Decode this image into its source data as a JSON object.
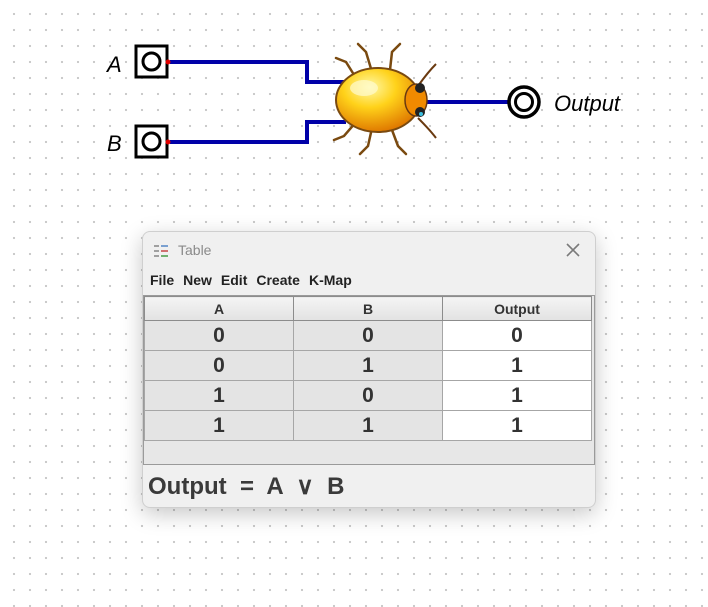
{
  "circuit": {
    "inputs": [
      {
        "label": "A"
      },
      {
        "label": "B"
      }
    ],
    "output": {
      "label": "Output"
    },
    "gate_icon": "ladybug-icon",
    "wire_color": "#0000a8",
    "pin_dot_color": "#e00000"
  },
  "dialog": {
    "title": "Table",
    "title_icon": "table-icon",
    "close_icon": "close-icon",
    "menu": [
      "File",
      "New",
      "Edit",
      "Create",
      "K-Map"
    ],
    "columns": [
      "A",
      "B",
      "Output"
    ],
    "rows": [
      [
        "0",
        "0",
        "0"
      ],
      [
        "0",
        "1",
        "1"
      ],
      [
        "1",
        "0",
        "1"
      ],
      [
        "1",
        "1",
        "1"
      ]
    ],
    "formula": "Output  =  A  ∨  B"
  }
}
